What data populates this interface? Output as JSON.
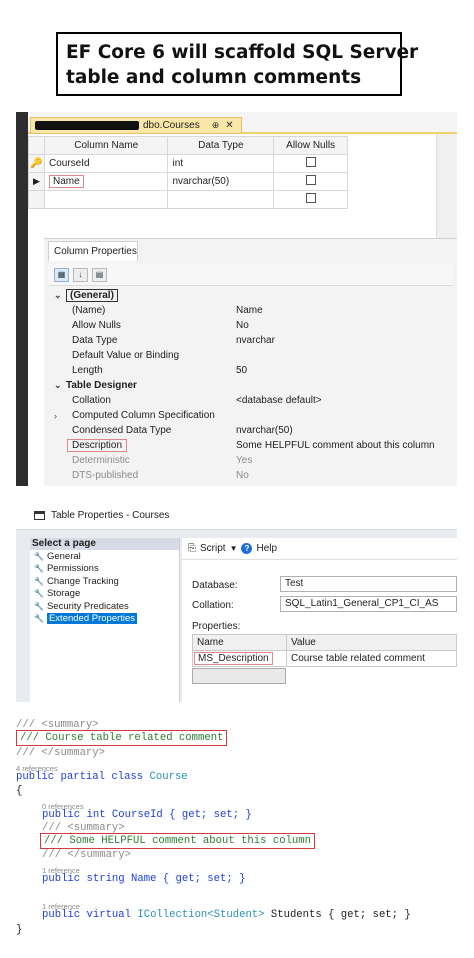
{
  "title": {
    "line1": "EF Core 6 will scaffold SQL Server",
    "line2": "table and column comments"
  },
  "designer": {
    "tab_label": "dbo.Courses",
    "tab_pin": "⊕",
    "tab_close": "✕",
    "columns": {
      "name": "Column Name",
      "type": "Data Type",
      "nulls": "Allow Nulls"
    },
    "rows": [
      {
        "name": "CourseId",
        "type": "int"
      },
      {
        "name": "Name",
        "type": "nvarchar(50)"
      }
    ],
    "column_properties_tab": "Column Properties",
    "general_category": "(General)",
    "general_props": [
      {
        "name": "(Name)",
        "value": "Name"
      },
      {
        "name": "Allow Nulls",
        "value": "No"
      },
      {
        "name": "Data Type",
        "value": "nvarchar"
      },
      {
        "name": "Default Value or Binding",
        "value": ""
      },
      {
        "name": "Length",
        "value": "50"
      }
    ],
    "table_designer_category": "Table Designer",
    "designer_props": [
      {
        "name": "Collation",
        "value": "<database default>"
      },
      {
        "name": "Computed Column Specification",
        "value": ""
      },
      {
        "name": "Condensed Data Type",
        "value": "nvarchar(50)"
      },
      {
        "name": "Description",
        "value": "Some HELPFUL comment about this column"
      },
      {
        "name": "Deterministic",
        "value": "Yes"
      },
      {
        "name": "DTS-published",
        "value": "No"
      }
    ]
  },
  "table_properties": {
    "window_title": "Table Properties - Courses",
    "select_page": "Select a page",
    "pages": [
      "General",
      "Permissions",
      "Change Tracking",
      "Storage",
      "Security Predicates",
      "Extended Properties"
    ],
    "script_label": "Script",
    "help_label": "Help",
    "database_label": "Database:",
    "database_value": "Test",
    "collation_label": "Collation:",
    "collation_value": "SQL_Latin1_General_CP1_CI_AS",
    "properties_label": "Properties:",
    "header_name": "Name",
    "header_value": "Value",
    "prop_name": "MS_Description",
    "prop_value": "Course table related comment"
  },
  "code": {
    "summary_open": "/// <summary>",
    "class_comment": "/// Course table related comment",
    "summary_close": "/// </summary>",
    "refs_4": "4 references",
    "class_decl_kw": "public partial class ",
    "class_name": "Course",
    "brace_open": "{",
    "refs_0": "0 references",
    "courseid_line": "public int CourseId { get; set; }",
    "col_comment": "/// Some HELPFUL comment about this column",
    "refs_1a": "1 reference",
    "name_line": "public string Name { get; set; }",
    "refs_1b": "1 reference",
    "students_kw": "public virtual ",
    "students_type": "ICollection",
    "students_generic": "<Student>",
    "students_rest": " Students { get; set; }",
    "brace_close": "}"
  },
  "colors": {
    "keyword": "#1f3fd6",
    "type": "#2b91af",
    "comment": "#2f7d32",
    "highlight_box": "#d13b3b"
  }
}
